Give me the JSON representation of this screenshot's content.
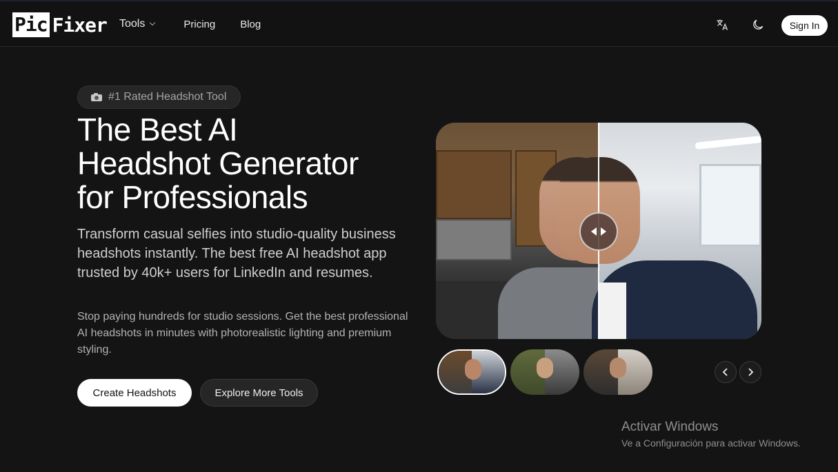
{
  "header": {
    "logo_left": "Pic",
    "logo_right": "Fixer",
    "nav": [
      "Tools",
      "Pricing",
      "Blog"
    ],
    "sign_in": "Sign In",
    "icons": [
      "translate-icon",
      "moon-icon"
    ]
  },
  "hero": {
    "badge": "#1 Rated Headshot Tool",
    "title_lines": [
      "The Best AI",
      "Headshot Generator",
      "for Professionals"
    ],
    "lead": "Transform casual selfies into studio-quality business headshots instantly. The best free AI headshot app trusted by 40k+ users for LinkedIn and resumes.",
    "sub": "Stop paying hundreds for studio sessions. Get the best professional AI headshots in minutes with photorealistic lighting and premium styling.",
    "primary_cta": "Create Headshots",
    "secondary_cta": "Explore More Tools"
  },
  "compare": {
    "thumbnails": 3,
    "active_thumbnail": 1
  },
  "watermark": {
    "title": "Activar Windows",
    "subtitle": "Ve a Configuración para activar Windows."
  }
}
